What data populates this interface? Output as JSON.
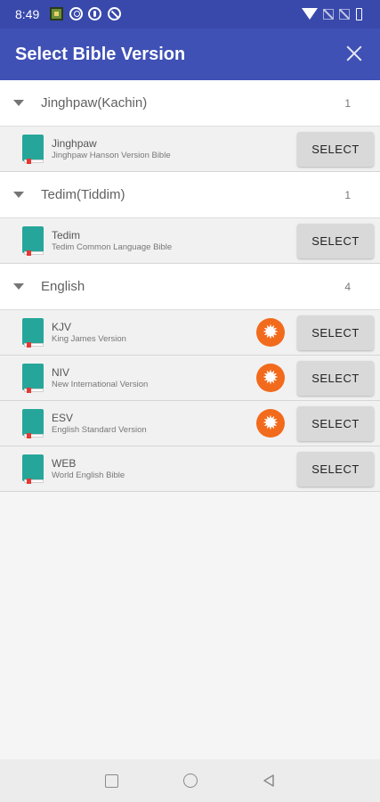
{
  "status_bar": {
    "time": "8:49"
  },
  "app_bar": {
    "title": "Select Bible Version"
  },
  "colors": {
    "app_bar": "#3f51b5",
    "status_bar": "#3949ab",
    "book_icon": "#26a69a",
    "settings_icon": "#f26a1b"
  },
  "groups": [
    {
      "name": "Jinghpaw(Kachin)",
      "count": "1",
      "versions": [
        {
          "abbr": "Jinghpaw",
          "full": "Jinghpaw Hanson Version Bible",
          "select_label": "SELECT"
        }
      ]
    },
    {
      "name": "Tedim(Tiddim)",
      "count": "1",
      "versions": [
        {
          "abbr": "Tedim",
          "full": "Tedim Common Language Bible",
          "select_label": "SELECT"
        }
      ]
    },
    {
      "name": "English",
      "count": "4",
      "versions": [
        {
          "abbr": "KJV",
          "full": "King James Version",
          "select_label": "SELECT"
        },
        {
          "abbr": "NIV",
          "full": "New International Version",
          "select_label": "SELECT"
        },
        {
          "abbr": "ESV",
          "full": "English Standard Version",
          "select_label": "SELECT"
        },
        {
          "abbr": "WEB",
          "full": "World English Bible",
          "select_label": "SELECT"
        }
      ]
    }
  ],
  "icons": {
    "close": "close-icon",
    "collapse": "caret-down-icon",
    "book": "bible-book-icon",
    "settings": "settings-gear-icon",
    "nav_recents": "square-icon",
    "nav_home": "circle-icon",
    "nav_back": "triangle-back-icon"
  }
}
